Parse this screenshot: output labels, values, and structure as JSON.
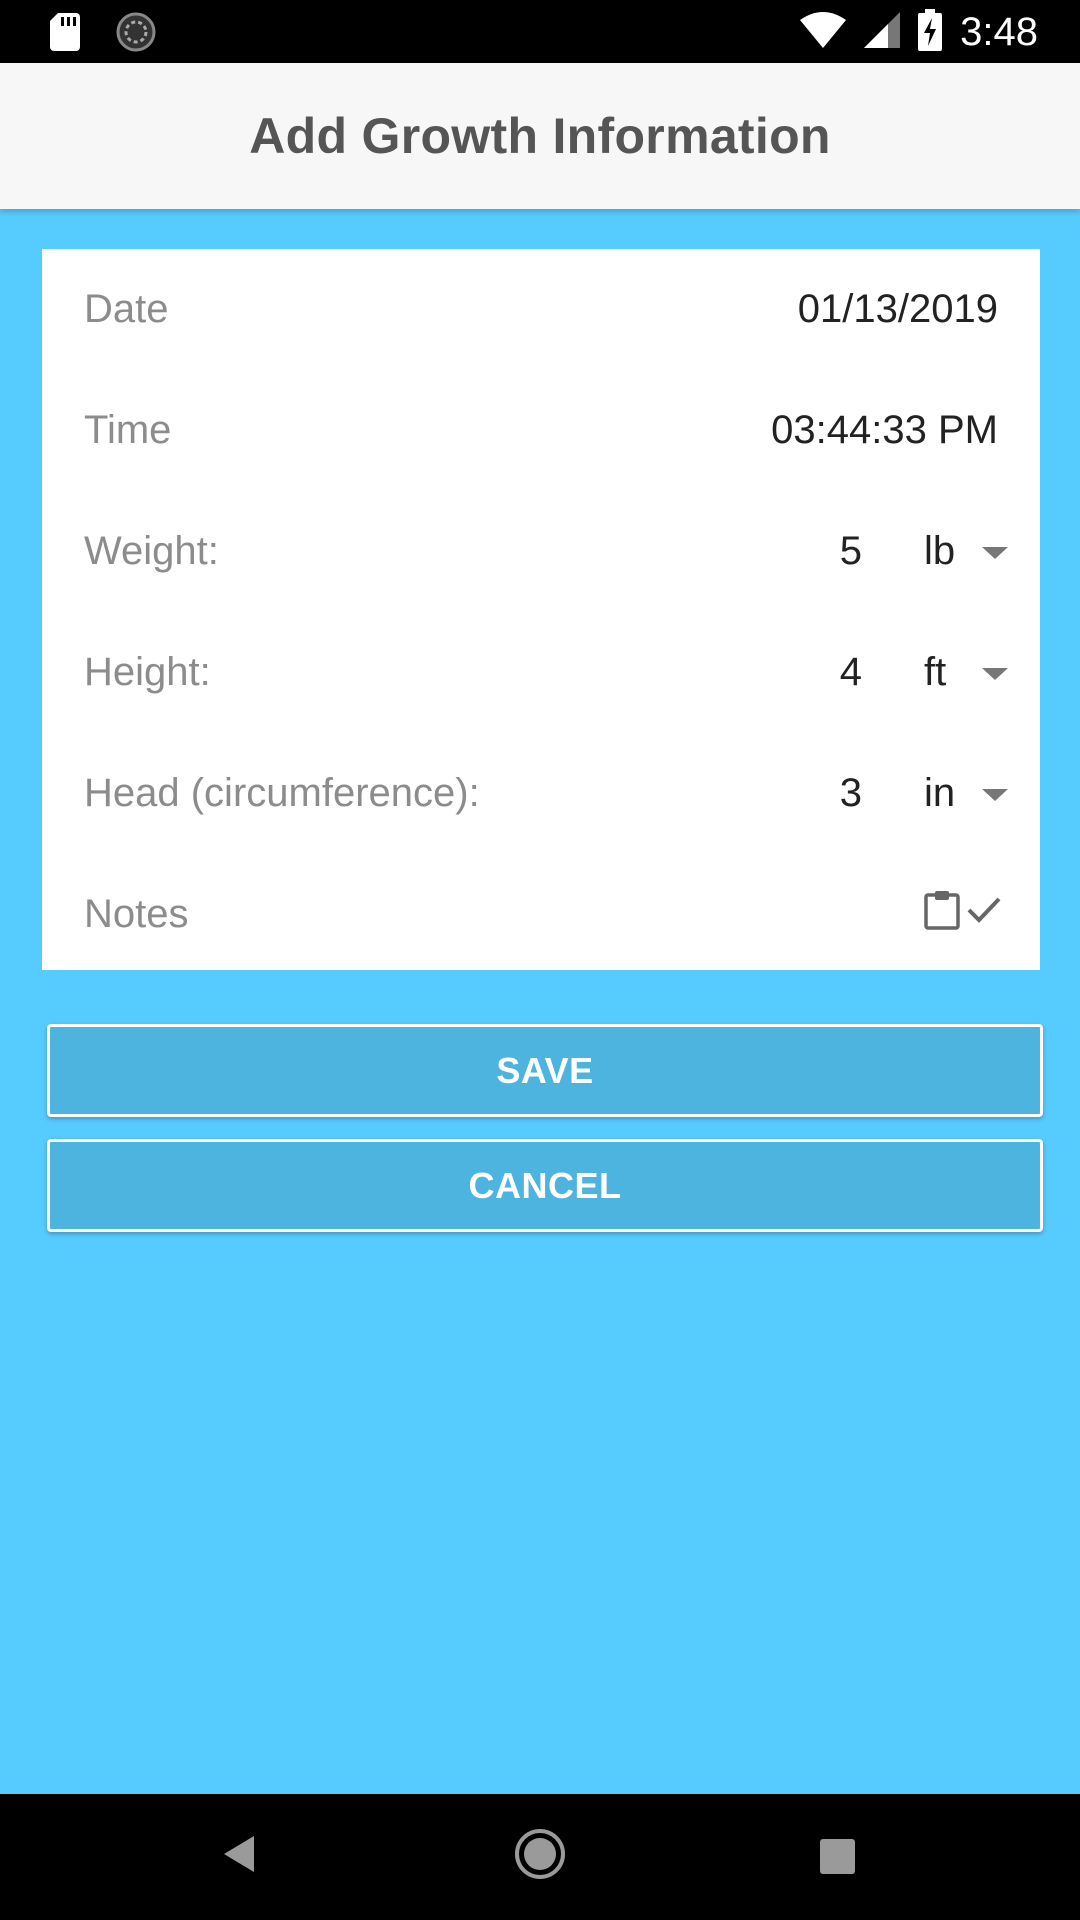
{
  "status_bar": {
    "time": "3:48",
    "icons": [
      "sd-card-icon",
      "sync-icon",
      "wifi-icon",
      "signal-icon",
      "battery-charging-icon"
    ]
  },
  "app_bar": {
    "title": "Add Growth Information"
  },
  "form": {
    "date": {
      "label": "Date",
      "value": "01/13/2019"
    },
    "time": {
      "label": "Time",
      "value": "03:44:33 PM"
    },
    "weight": {
      "label": "Weight:",
      "value": "5",
      "unit": "lb"
    },
    "height": {
      "label": "Height:",
      "value": "4",
      "unit": "ft"
    },
    "head": {
      "label": "Head (circumference):",
      "value": "3",
      "unit": "in"
    },
    "notes": {
      "label": "Notes",
      "icons": [
        "clipboard-icon",
        "check-icon"
      ]
    }
  },
  "buttons": {
    "save": "SAVE",
    "cancel": "CANCEL"
  },
  "colors": {
    "background": "#56CBFD",
    "button": "#4DB3DF",
    "app_bar": "#F7F7F7"
  },
  "nav_bar": {
    "icons": [
      "back-icon",
      "home-icon",
      "recents-icon"
    ]
  }
}
